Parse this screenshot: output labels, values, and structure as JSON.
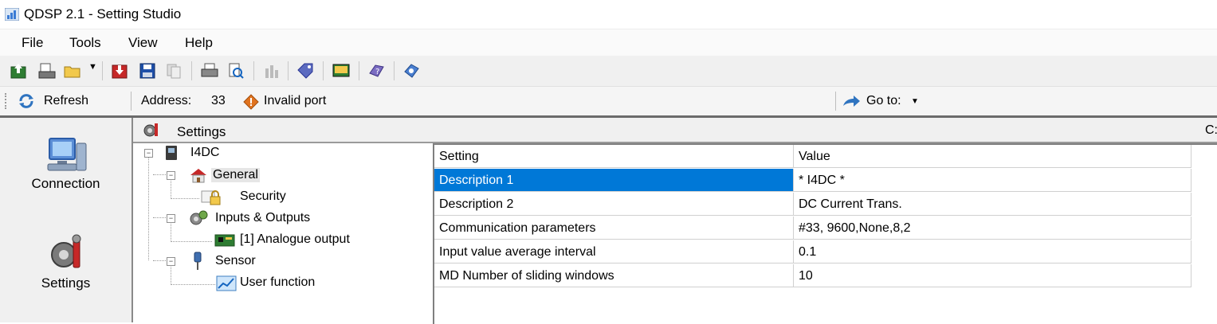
{
  "window": {
    "title": "QDSP 2.1 - Setting Studio"
  },
  "menu": {
    "items": [
      "File",
      "Tools",
      "View",
      "Help"
    ]
  },
  "toolbar": {
    "icons": [
      "upload-icon",
      "print-device-icon",
      "open-folder-icon",
      "download-icon",
      "save-icon",
      "copy-icon",
      "print-icon",
      "print-preview-icon",
      "bar-chart-icon",
      "tag-icon",
      "monitor-icon",
      "help-icon",
      "settings-help-icon"
    ]
  },
  "addressbar": {
    "refresh_label": "Refresh",
    "address_label": "Address:",
    "address_value": "33",
    "status_text": "Invalid port",
    "goto_label": "Go to:"
  },
  "leftnav": {
    "items": [
      {
        "label": "Connection",
        "icon": "computer-icon"
      },
      {
        "label": "Settings",
        "icon": "settings-gear-icon"
      }
    ]
  },
  "settings_panel": {
    "title": "Settings",
    "right_clip": "C:"
  },
  "tree": {
    "nodes": [
      {
        "label": "I4DC",
        "icon": "device-icon"
      },
      {
        "label": "General",
        "icon": "house-icon"
      },
      {
        "label": "Security",
        "icon": "lock-icon"
      },
      {
        "label": "Inputs & Outputs",
        "icon": "gear-icon"
      },
      {
        "label": "[1] Analogue output",
        "icon": "board-icon"
      },
      {
        "label": "Sensor",
        "icon": "sensor-icon"
      },
      {
        "label": "User function",
        "icon": "graph-icon"
      }
    ]
  },
  "grid": {
    "headers": [
      "Setting",
      "Value"
    ],
    "rows": [
      {
        "setting": "Description 1",
        "value": "* I4DC *",
        "selected": true
      },
      {
        "setting": "Description 2",
        "value": "DC Current Trans.",
        "selected": false
      },
      {
        "setting": "Communication parameters",
        "value": "#33, 9600,None,8,2",
        "selected": false
      },
      {
        "setting": "Input value average interval",
        "value": "0.1",
        "selected": false
      },
      {
        "setting": "MD Number of sliding windows",
        "value": "10",
        "selected": false
      }
    ]
  }
}
